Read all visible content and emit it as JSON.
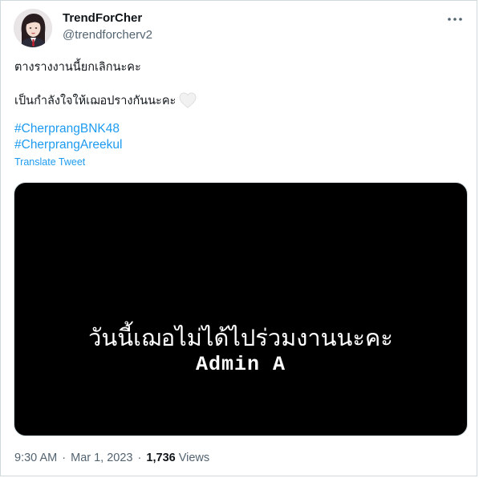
{
  "tweet": {
    "author": {
      "display_name": "TrendForCher",
      "handle": "@trendforcherv2"
    },
    "text_lines": [
      "ตางรางงานนี้ยกเลิกนะคะ",
      "เป็นกำลังใจให้เฌอปรางกันนะคะ"
    ],
    "hashtags": [
      "#CherprangBNK48",
      "#CherprangAreekul"
    ],
    "translate_label": "Translate Tweet",
    "media": {
      "caption_line_1": "วันนี้เฌอไม่ได้ไปร่วมงานนะคะ",
      "caption_line_2": "Admin A"
    },
    "meta": {
      "time": "9:30 AM",
      "separator": "·",
      "date": "Mar 1, 2023",
      "views_count": "1,736",
      "views_label": "Views"
    }
  },
  "icons": {
    "more": "more-dots-icon",
    "heart": "white-heart-icon",
    "avatar": "profile-photo"
  },
  "colors": {
    "link": "#1d9bf0",
    "text": "#0f1419",
    "secondary": "#536471",
    "border": "#cfd9de",
    "media_bg": "#000000"
  }
}
